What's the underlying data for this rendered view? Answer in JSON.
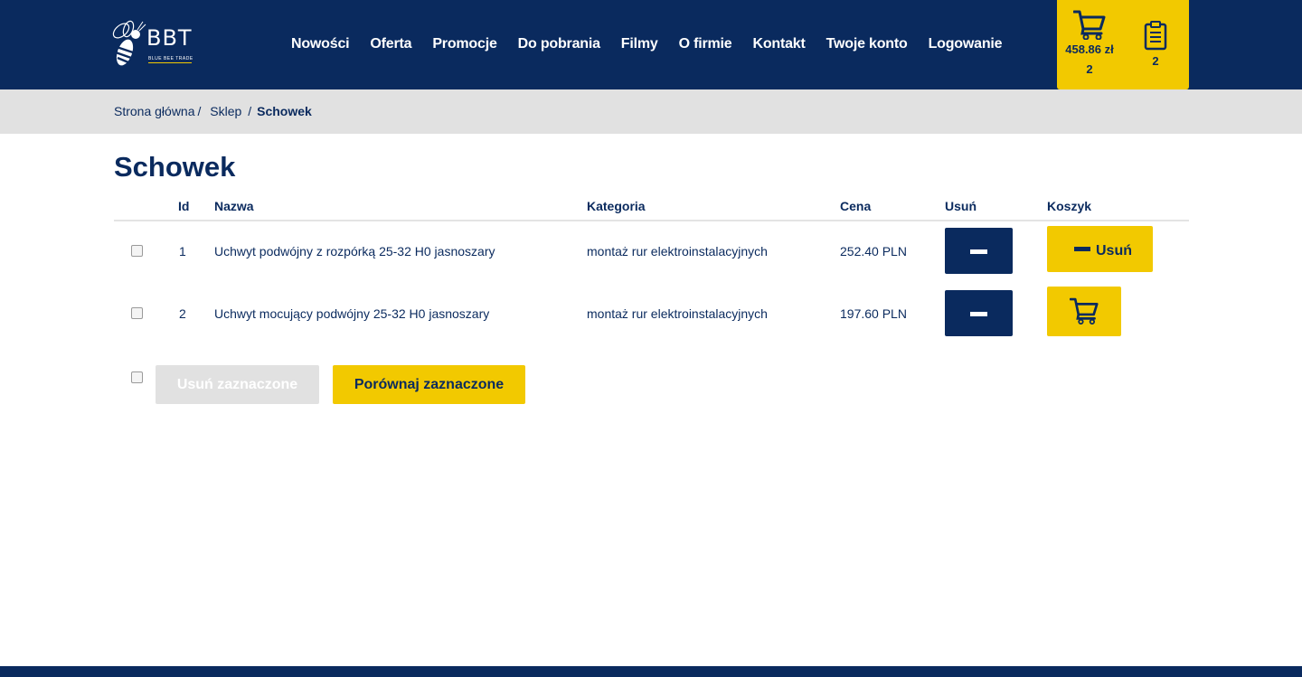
{
  "logo": {
    "text": "BBT",
    "subtitle": "BLUE BEE TRADE"
  },
  "nav": {
    "items": [
      "Nowości",
      "Oferta",
      "Promocje",
      "Do pobrania",
      "Filmy",
      "O firmie",
      "Kontakt",
      "Twoje konto",
      "Logowanie"
    ]
  },
  "cart": {
    "total": "458.86 zł",
    "count": "2",
    "clipboard_count": "2"
  },
  "breadcrumb": {
    "home": "Strona główna",
    "shop": "Sklep",
    "current": "Schowek",
    "separator": "/"
  },
  "page": {
    "title": "Schowek"
  },
  "table": {
    "headers": {
      "id": "Id",
      "name": "Nazwa",
      "category": "Kategoria",
      "price": "Cena",
      "remove": "Usuń",
      "cart": "Koszyk"
    },
    "rows": [
      {
        "id": "1",
        "name": "Uchwyt podwójny z rozpórką 25-32 H0 jasnoszary",
        "category": "montaż rur elektroinstalacyjnych",
        "price": "252.40 PLN",
        "cart_action": "Usuń",
        "in_cart": true
      },
      {
        "id": "2",
        "name": "Uchwyt mocujący podwójny 25-32 H0 jasnoszary",
        "category": "montaż rur elektroinstalacyjnych",
        "price": "197.60 PLN",
        "cart_action": "",
        "in_cart": false
      }
    ]
  },
  "actions": {
    "remove_selected": "Usuń zaznaczone",
    "compare_selected": "Porównaj zaznaczone"
  },
  "colors": {
    "navy": "#0a2a5e",
    "yellow": "#f2c900",
    "gray": "#e1e1e1"
  },
  "icons": {
    "cart": "cart-icon",
    "clipboard": "clipboard-icon",
    "minus": "minus-icon",
    "bee": "bee-logo-icon"
  }
}
